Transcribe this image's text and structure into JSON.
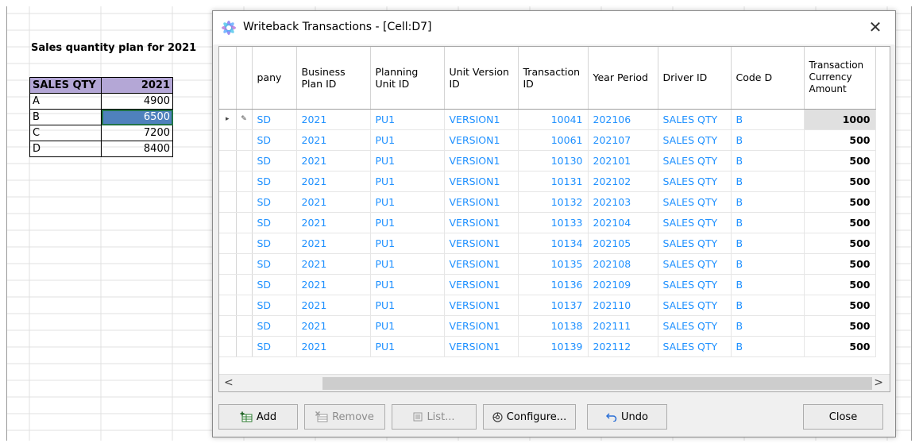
{
  "sheet": {
    "title": "Sales quantity plan for 2021",
    "table": {
      "headers": [
        "SALES QTY",
        "2021"
      ],
      "rows": [
        {
          "label": "A",
          "value": "4900"
        },
        {
          "label": "B",
          "value": "6500"
        },
        {
          "label": "C",
          "value": "7200"
        },
        {
          "label": "D",
          "value": "8400"
        }
      ],
      "header_color": "#b4a7d6",
      "selected_fill": "#4f81bd"
    }
  },
  "dialog": {
    "title": "Writeback Transactions - [Cell:D7]",
    "close_glyph": "✕",
    "columns": [
      "pany",
      "Business Plan ID",
      "Planning Unit ID",
      "Unit Version ID",
      "Transaction ID",
      "Year Period",
      "Driver ID",
      "Code D",
      "Transaction Currency Amount"
    ],
    "rows": [
      {
        "indicator": "▸",
        "edit": "✎",
        "company": "SD",
        "plan": "2021",
        "unit": "PU1",
        "version": "VERSION1",
        "tx_id": "10041",
        "period": "202106",
        "driver": "SALES QTY",
        "code": "B",
        "amount": "1000"
      },
      {
        "indicator": "",
        "edit": "",
        "company": "SD",
        "plan": "2021",
        "unit": "PU1",
        "version": "VERSION1",
        "tx_id": "10061",
        "period": "202107",
        "driver": "SALES QTY",
        "code": "B",
        "amount": "500"
      },
      {
        "indicator": "",
        "edit": "",
        "company": "SD",
        "plan": "2021",
        "unit": "PU1",
        "version": "VERSION1",
        "tx_id": "10130",
        "period": "202101",
        "driver": "SALES QTY",
        "code": "B",
        "amount": "500"
      },
      {
        "indicator": "",
        "edit": "",
        "company": "SD",
        "plan": "2021",
        "unit": "PU1",
        "version": "VERSION1",
        "tx_id": "10131",
        "period": "202102",
        "driver": "SALES QTY",
        "code": "B",
        "amount": "500"
      },
      {
        "indicator": "",
        "edit": "",
        "company": "SD",
        "plan": "2021",
        "unit": "PU1",
        "version": "VERSION1",
        "tx_id": "10132",
        "period": "202103",
        "driver": "SALES QTY",
        "code": "B",
        "amount": "500"
      },
      {
        "indicator": "",
        "edit": "",
        "company": "SD",
        "plan": "2021",
        "unit": "PU1",
        "version": "VERSION1",
        "tx_id": "10133",
        "period": "202104",
        "driver": "SALES QTY",
        "code": "B",
        "amount": "500"
      },
      {
        "indicator": "",
        "edit": "",
        "company": "SD",
        "plan": "2021",
        "unit": "PU1",
        "version": "VERSION1",
        "tx_id": "10134",
        "period": "202105",
        "driver": "SALES QTY",
        "code": "B",
        "amount": "500"
      },
      {
        "indicator": "",
        "edit": "",
        "company": "SD",
        "plan": "2021",
        "unit": "PU1",
        "version": "VERSION1",
        "tx_id": "10135",
        "period": "202108",
        "driver": "SALES QTY",
        "code": "B",
        "amount": "500"
      },
      {
        "indicator": "",
        "edit": "",
        "company": "SD",
        "plan": "2021",
        "unit": "PU1",
        "version": "VERSION1",
        "tx_id": "10136",
        "period": "202109",
        "driver": "SALES QTY",
        "code": "B",
        "amount": "500"
      },
      {
        "indicator": "",
        "edit": "",
        "company": "SD",
        "plan": "2021",
        "unit": "PU1",
        "version": "VERSION1",
        "tx_id": "10137",
        "period": "202110",
        "driver": "SALES QTY",
        "code": "B",
        "amount": "500"
      },
      {
        "indicator": "",
        "edit": "",
        "company": "SD",
        "plan": "2021",
        "unit": "PU1",
        "version": "VERSION1",
        "tx_id": "10138",
        "period": "202111",
        "driver": "SALES QTY",
        "code": "B",
        "amount": "500"
      },
      {
        "indicator": "",
        "edit": "",
        "company": "SD",
        "plan": "2021",
        "unit": "PU1",
        "version": "VERSION1",
        "tx_id": "10139",
        "period": "202112",
        "driver": "SALES QTY",
        "code": "B",
        "amount": "500"
      }
    ],
    "scroll": {
      "left": "<",
      "right": ">"
    },
    "buttons": {
      "add": "Add",
      "remove": "Remove",
      "list": "List...",
      "configure": "Configure...",
      "undo": "Undo",
      "close": "Close"
    },
    "link_color": "#1e90ff"
  }
}
